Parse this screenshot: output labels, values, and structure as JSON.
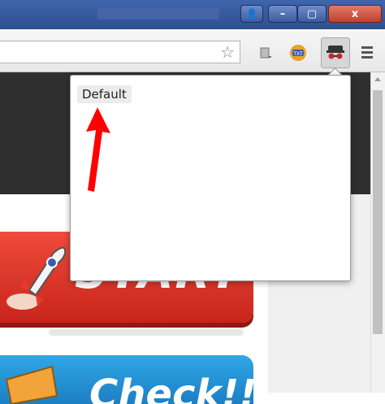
{
  "window": {
    "profile_button": "👤",
    "minimize_label": "–",
    "maximize_label": "▢",
    "close_label": "x"
  },
  "toolbar": {
    "bookmark_star": "☆",
    "extensions": [
      "page-action-icon",
      "itxt-extension-icon",
      "incognito-profile-icon"
    ],
    "menu_icon": "hamburger-menu-icon"
  },
  "popup": {
    "items": [
      "Default"
    ]
  },
  "page": {
    "start_button": "START",
    "check_button": "Check!!"
  },
  "colors": {
    "titlebar": "#3f65ad",
    "start_red": "#e33a2c",
    "check_blue": "#2a9ee0",
    "annotation_arrow": "#ff0000"
  }
}
